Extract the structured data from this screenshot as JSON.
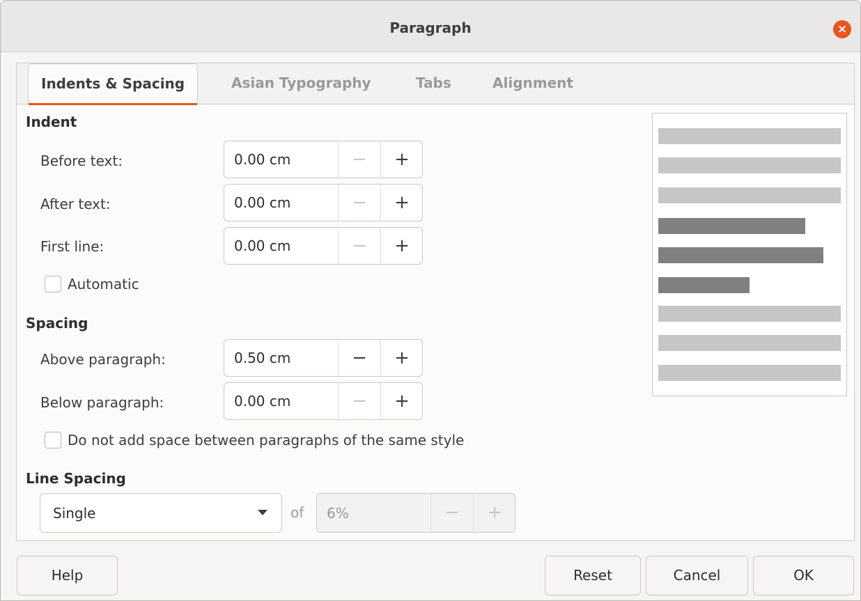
{
  "window": {
    "title": "Paragraph",
    "close_glyph": "×"
  },
  "tabs": [
    {
      "label": "Indents & Spacing"
    },
    {
      "label": "Asian Typography"
    },
    {
      "label": "Tabs"
    },
    {
      "label": "Alignment"
    }
  ],
  "indent": {
    "title": "Indent",
    "before_text": {
      "label": "Before text:",
      "value": "0.00 cm"
    },
    "after_text": {
      "label": "After text:",
      "value": "0.00 cm"
    },
    "first_line": {
      "label": "First line:",
      "value": "0.00 cm"
    },
    "automatic": {
      "label": "Automatic",
      "checked": false
    }
  },
  "spacing": {
    "title": "Spacing",
    "above": {
      "label": "Above paragraph:",
      "value": "0.50 cm"
    },
    "below": {
      "label": "Below paragraph:",
      "value": "0.00 cm"
    },
    "no_space_same_style": {
      "label": "Do not add space between paragraphs of the same style",
      "checked": false
    }
  },
  "line_spacing": {
    "title": "Line Spacing",
    "selected": "Single",
    "of_label": "of",
    "of_value": "6%"
  },
  "spin_glyphs": {
    "minus": "−",
    "plus": "+"
  },
  "buttons": {
    "help": "Help",
    "reset": "Reset",
    "cancel": "Cancel",
    "ok": "OK"
  },
  "colors": {
    "accent": "#e95420",
    "preview_light": "#c6c6c6",
    "preview_dark": "#808080"
  }
}
